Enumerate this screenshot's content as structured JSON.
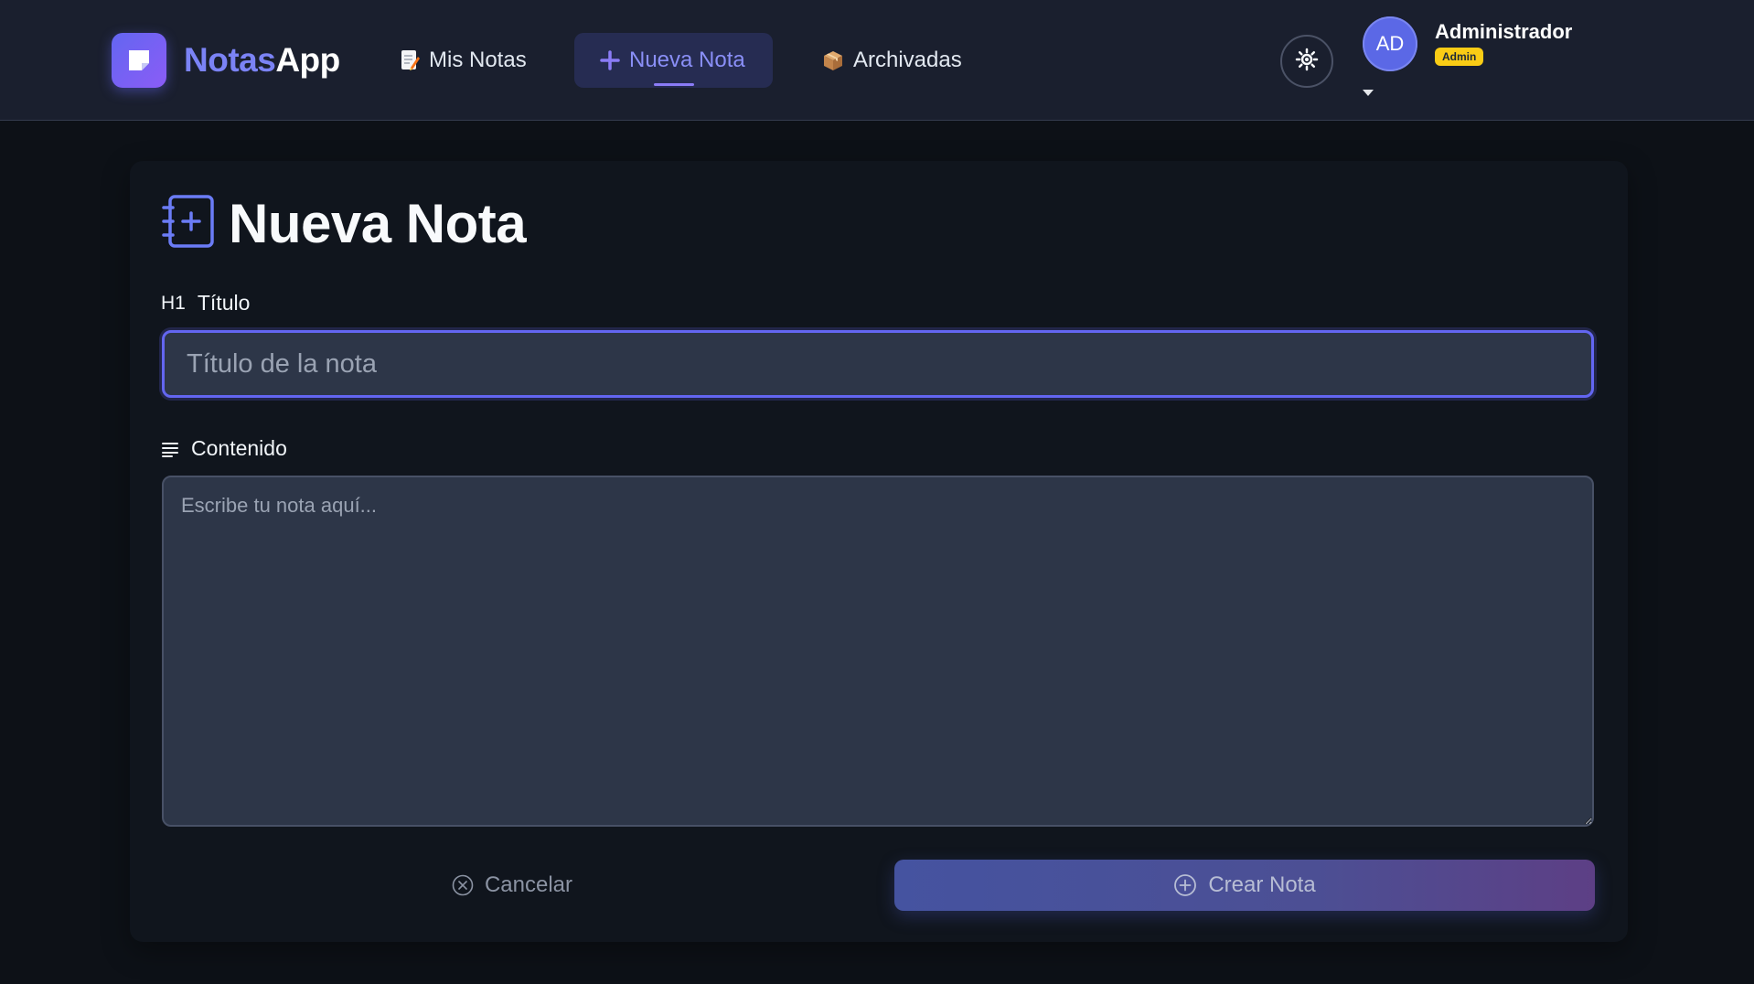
{
  "brand": {
    "name_part1": "Notas",
    "name_part2": "App"
  },
  "nav": [
    {
      "label": "Mis Notas",
      "icon": "memo-icon"
    },
    {
      "label": "Nueva Nota",
      "icon": "plus-icon",
      "active": true
    },
    {
      "label": "Archivadas",
      "icon": "package-icon"
    }
  ],
  "theme_toggle": {
    "icon": "sun-icon"
  },
  "user": {
    "initials": "AD",
    "name": "Administrador",
    "role_badge": "Admin"
  },
  "page": {
    "title": "Nueva Nota",
    "icon": "note-add-icon"
  },
  "form": {
    "title_field": {
      "label_prefix": "H1",
      "label": "Título",
      "placeholder": "Título de la nota",
      "value": ""
    },
    "content_field": {
      "label": "Contenido",
      "placeholder": "Escribe tu nota aquí...",
      "value": ""
    }
  },
  "actions": {
    "cancel_label": "Cancelar",
    "create_label": "Crear Nota"
  },
  "colors": {
    "accent": "#6366f1",
    "background": "#0d1117",
    "navbar": "#1a1f2e",
    "badge": "#facc15"
  }
}
